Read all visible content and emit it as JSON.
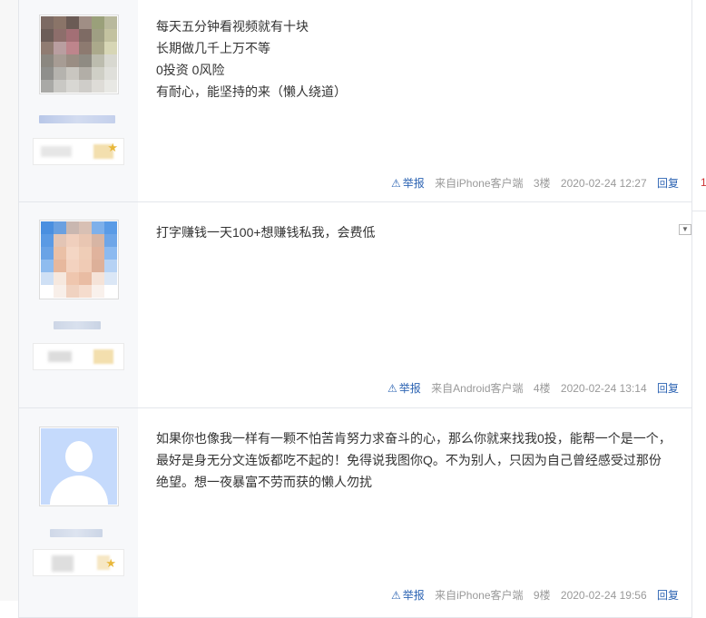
{
  "side_marker": "1",
  "posts": [
    {
      "content_lines": [
        "每天五分钟看视频就有十块",
        "长期做几千上万不等",
        "0投资 0风险",
        "有耐心，能坚持的来（懒人绕道）"
      ],
      "report": "举报",
      "client": "来自iPhone客户端",
      "floor": "3楼",
      "time": "2020-02-24 12:27",
      "reply": "回复"
    },
    {
      "content_lines": [
        "打字赚钱一天100+想赚钱私我，会费低"
      ],
      "report": "举报",
      "client": "来自Android客户端",
      "floor": "4楼",
      "time": "2020-02-24 13:14",
      "reply": "回复"
    },
    {
      "content_lines": [
        "如果你也像我一样有一颗不怕苦肯努力求奋斗的心，那么你就来找我0投，能帮一个是一个，",
        "最好是身无分文连饭都吃不起的！免得说我图你Q。不为别人，只因为自己曾经感受过那份",
        "绝望。想一夜暴富不劳而获的懒人勿扰"
      ],
      "report": "举报",
      "client": "来自iPhone客户端",
      "floor": "9楼",
      "time": "2020-02-24 19:56",
      "reply": "回复"
    }
  ]
}
